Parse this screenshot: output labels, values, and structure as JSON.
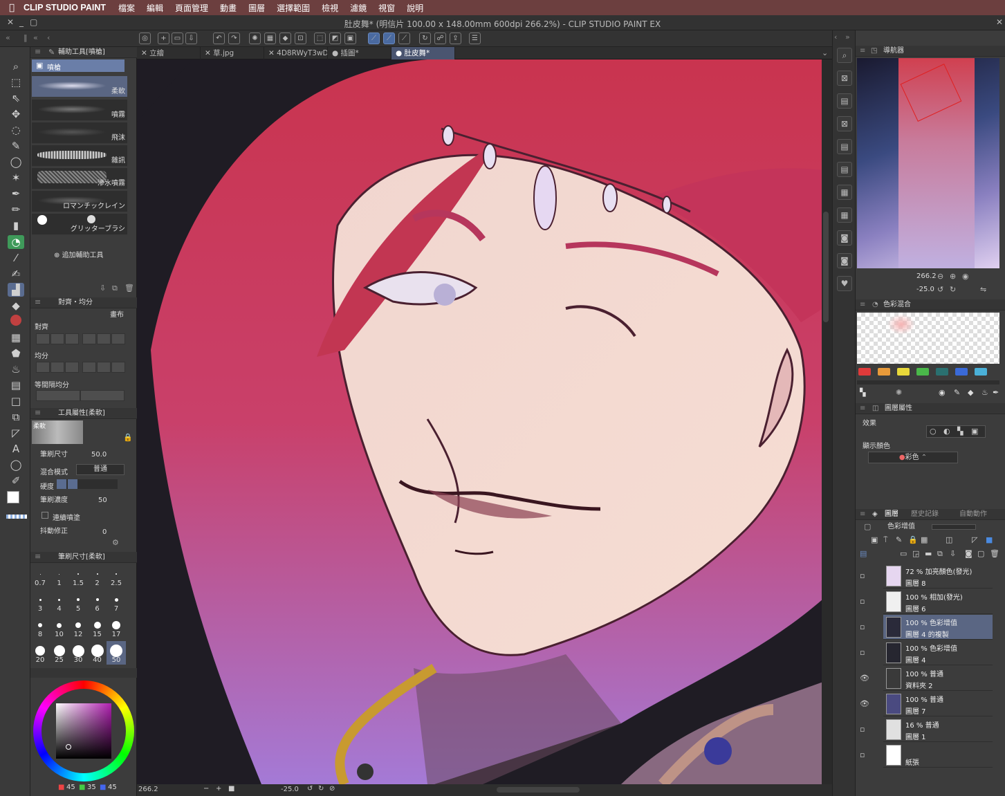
{
  "menubar": {
    "apple": "",
    "app_name": "CLIP STUDIO PAINT",
    "items": [
      "檔案",
      "編輯",
      "頁面管理",
      "動畫",
      "圖層",
      "選擇範圍",
      "檢視",
      "濾鏡",
      "視窗",
      "說明"
    ]
  },
  "window": {
    "title": "肚皮舞* (明信片 100.00 x 148.00mm 600dpi 266.2%) - CLIP STUDIO PAINT EX"
  },
  "document_tabs": [
    {
      "label": "立繪",
      "active": false
    },
    {
      "label": "草.jpg",
      "active": false
    },
    {
      "label": "4D8RWyT3wD",
      "active": false
    },
    {
      "label": "插圖*",
      "active": false
    },
    {
      "label": "肚皮舞*",
      "active": true
    }
  ],
  "subtool_panel": {
    "title": "輔助工具[噴槍]",
    "group": "噴槍",
    "brushes": [
      "柔軟",
      "噴霧",
      "飛沫",
      "雜訊",
      "滲水噴霧",
      "ロマンチックレイン",
      "グリッターブラシ"
    ],
    "add_button": "追加輔助工具"
  },
  "align_panel": {
    "title": "對齊・均分",
    "canvas_label": "畫布",
    "align_label": "對齊",
    "distribute_label": "均分",
    "equal_spacing_label": "等間隔均分"
  },
  "tool_property": {
    "title": "工具屬性[柔軟]",
    "preview_label": "柔軟",
    "brush_size_label": "筆刷尺寸",
    "brush_size_value": "50.0",
    "blend_mode_label": "混合模式",
    "blend_mode_value": "普通",
    "hardness_label": "硬度",
    "density_label": "筆刷濃度",
    "density_value": "50",
    "continuous_spray_label": "連續噴塗",
    "stabilization_label": "抖動修正",
    "stabilization_value": "0"
  },
  "brush_size_panel": {
    "title": "筆刷尺寸[柔軟]",
    "sizes": [
      "0.7",
      "1",
      "1.5",
      "2",
      "2.5",
      "3",
      "4",
      "5",
      "6",
      "7",
      "8",
      "10",
      "12",
      "15",
      "17",
      "20",
      "25",
      "30",
      "40",
      "50"
    ],
    "selected": "50"
  },
  "color_wheel": {
    "h": "45",
    "s": "35",
    "v": "45",
    "accent": "#b01fb0"
  },
  "status": {
    "zoom": "266.2",
    "rotation": "-25.0"
  },
  "navigator": {
    "title": "導航器",
    "zoom": "266.2",
    "rotation": "-25.0"
  },
  "color_mix": {
    "title": "色彩混合",
    "swatches": [
      "#e03a3a",
      "#e89a3a",
      "#e8d83a",
      "#4ab84a",
      "#2a7070",
      "#3a6ad8",
      "#4ab0d8"
    ]
  },
  "layer_property": {
    "title": "圖層屬性",
    "effect_label": "效果",
    "display_color_label": "顯示顏色",
    "display_color_value": "彩色"
  },
  "layer_panel": {
    "tab_layers": "圖層",
    "tab_history": "歷史記錄",
    "tab_auto": "自動動作",
    "blend_mode": "色彩增值",
    "layers": [
      {
        "mode": "72 % 加亮顏色(發光)",
        "name": "圖層 8",
        "selected": false,
        "visible": false
      },
      {
        "mode": "100 % 相加(發光)",
        "name": "圖層 6",
        "selected": false,
        "visible": false
      },
      {
        "mode": "100 % 色彩增值",
        "name": "圖層 4 的複製",
        "selected": true,
        "visible": false
      },
      {
        "mode": "100 % 色彩增值",
        "name": "圖層 4",
        "selected": false,
        "visible": false
      },
      {
        "mode": "100 % 普通",
        "name": "資料夾 2",
        "selected": false,
        "visible": true
      },
      {
        "mode": "100 % 普通",
        "name": "圖層 7",
        "selected": false,
        "visible": true
      },
      {
        "mode": "16 % 普通",
        "name": "圖層 1",
        "selected": false,
        "visible": false
      },
      {
        "mode": "",
        "name": "紙張",
        "selected": false,
        "visible": false
      }
    ]
  }
}
